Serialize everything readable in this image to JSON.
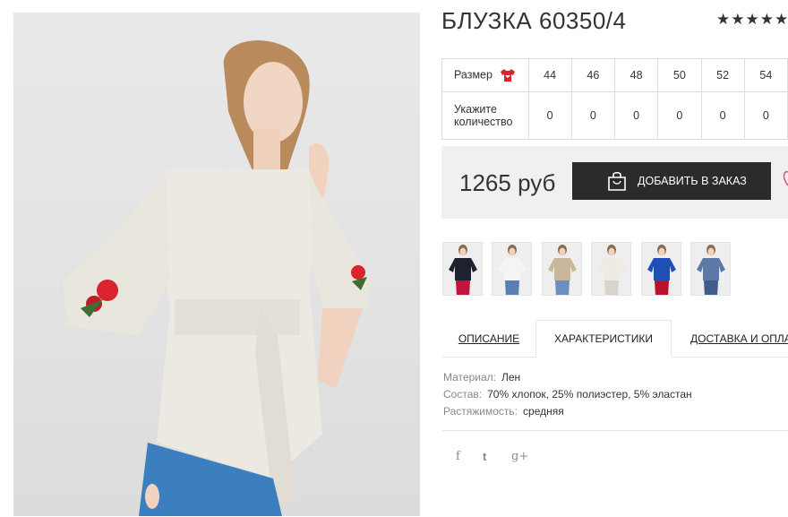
{
  "product": {
    "title": "БЛУЗКА 60350/4",
    "rating_stars": "★★★★★"
  },
  "size_table": {
    "size_label": "Размер",
    "qty_label": "Укажите количество",
    "sizes": [
      "44",
      "46",
      "48",
      "50",
      "52",
      "54"
    ],
    "quantities": [
      "0",
      "0",
      "0",
      "0",
      "0",
      "0"
    ]
  },
  "purchase": {
    "price": "1265 руб",
    "add_to_order": "ДОБАВИТЬ В ЗАКАЗ"
  },
  "thumbnails": [
    {
      "name": "black",
      "top_color": "#1e2230",
      "bottom_color": "#c0143c"
    },
    {
      "name": "white-red",
      "top_color": "#f4f4f4",
      "bottom_color": "#5a7fb5"
    },
    {
      "name": "beige",
      "top_color": "#c9b79c",
      "bottom_color": "#6d8fbf"
    },
    {
      "name": "ivory",
      "top_color": "#efebe4",
      "bottom_color": "#d8d4cc"
    },
    {
      "name": "royal-blue",
      "top_color": "#1f4fb5",
      "bottom_color": "#b8122e"
    },
    {
      "name": "denim",
      "top_color": "#5d79a6",
      "bottom_color": "#3f5c8c"
    }
  ],
  "tabs": {
    "description": "ОПИСАНИЕ",
    "characteristics": "ХАРАКТЕРИСТИКИ",
    "delivery": "ДОСТАВКА И ОПЛАТА"
  },
  "specs": [
    {
      "key": "Материал:",
      "value": "Лен"
    },
    {
      "key": "Состав:",
      "value": "70% хлопок, 25% полиэстер, 5% эластан"
    },
    {
      "key": "Растяжимость:",
      "value": "средняя"
    }
  ],
  "social": {
    "facebook": "f",
    "twitter": "t",
    "google_plus": "g+"
  },
  "colors": {
    "button_bg": "#2b2b2b",
    "price_bar_bg": "#f0f0f0",
    "accent_red": "#d9232e",
    "heart": "#e05a7a"
  }
}
